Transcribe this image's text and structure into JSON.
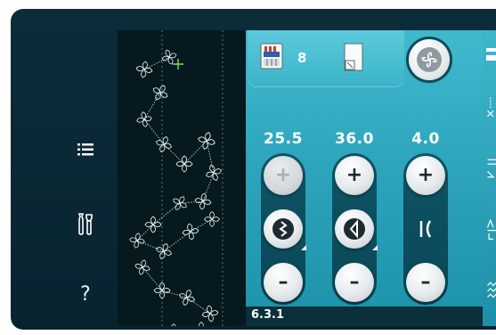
{
  "left_rail": {
    "items": [
      {
        "name": "list-icon"
      },
      {
        "name": "tools-icon"
      },
      {
        "name": "help-icon",
        "glyph": "?"
      }
    ]
  },
  "top_row": {
    "needle_threader_count": "8",
    "icons": [
      "presser-foot-icon",
      "sheet-icon",
      "pattern-start-icon"
    ]
  },
  "controls": [
    {
      "value": "25.5",
      "top_label": "+",
      "mid_icon": "stitch-width-icon",
      "bottom_label": "–",
      "plus_disabled": true
    },
    {
      "value": "36.0",
      "top_label": "+",
      "mid_icon": "stitch-length-icon",
      "bottom_label": "–",
      "plus_disabled": false
    },
    {
      "value": "4.0",
      "top_label": "+",
      "mid_icon": "balance-icon",
      "bottom_label": "–",
      "plus_disabled": false
    }
  ],
  "status_bar": {
    "text": "6.3.1"
  },
  "colors": {
    "frame_bg": "#082330",
    "panel_teal": "#2ea6bd",
    "preview_bg": "#05191f",
    "cursor_green": "#7ee05a"
  }
}
